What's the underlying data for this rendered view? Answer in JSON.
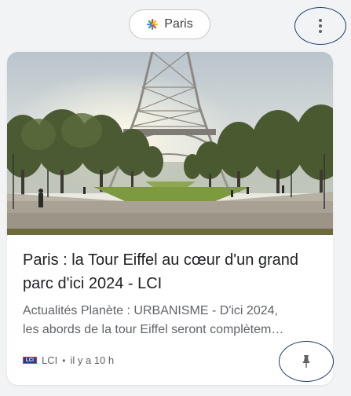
{
  "topic_chip": {
    "label": "Paris",
    "icon": "google-star-icon"
  },
  "more_menu": {
    "icon": "vertical-dots-icon"
  },
  "card": {
    "image_alt": "Eiffel Tower with tree-lined park",
    "title_lines": [
      "Paris : la Tour Eiffel au cœur d'un grand",
      "parc d'ici 2024 - LCI"
    ],
    "snippet_lines": [
      "Actualités Planète : URBANISME - D'ici 2024,",
      "les abords de la tour Eiffel seront complètem…"
    ],
    "source": {
      "logo_text": "LCI",
      "name": "LCI",
      "separator": "•",
      "time": "il y a 10 h"
    },
    "bottom_button_icon": "pin-icon"
  },
  "colors": {
    "background": "#f1f3f4",
    "card": "#ffffff",
    "highlight_ring": "#1f3a6e",
    "title": "#202124",
    "secondary_text": "#5f6368",
    "chip_border": "#c4c7c5"
  }
}
